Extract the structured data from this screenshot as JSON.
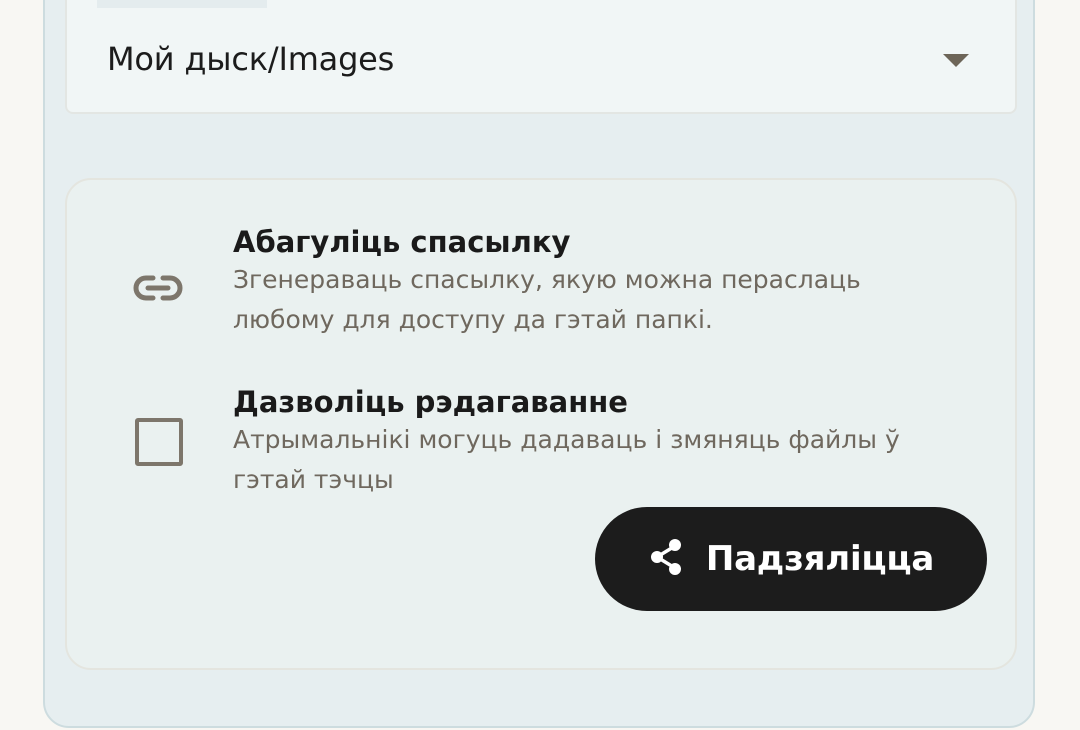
{
  "folder": {
    "value": "Мой дыск/Images",
    "arrow_icon": "dropdown-arrow-icon"
  },
  "options": [
    {
      "title": "Абагуліць спасылку",
      "description_line1": "Згенераваць спасылку, якую можна пераслаць",
      "description_line2": "любому для доступу да гэтай папкі.",
      "icon": "link-icon"
    },
    {
      "title": "Дазволіць рэдагаванне",
      "description_line1": "Атрымальнікі могуць дадаваць і змяняць файлы ў",
      "description_line2": "гэтай тэчцы",
      "checked": false
    }
  ],
  "share_button": {
    "label": "Падзяліцца",
    "icon": "share-icon"
  },
  "colors": {
    "page_background": "#f8f7f3",
    "card_background": "#e6eef0",
    "button_background": "#1c1c1c",
    "secondary_text": "#6f685e"
  }
}
